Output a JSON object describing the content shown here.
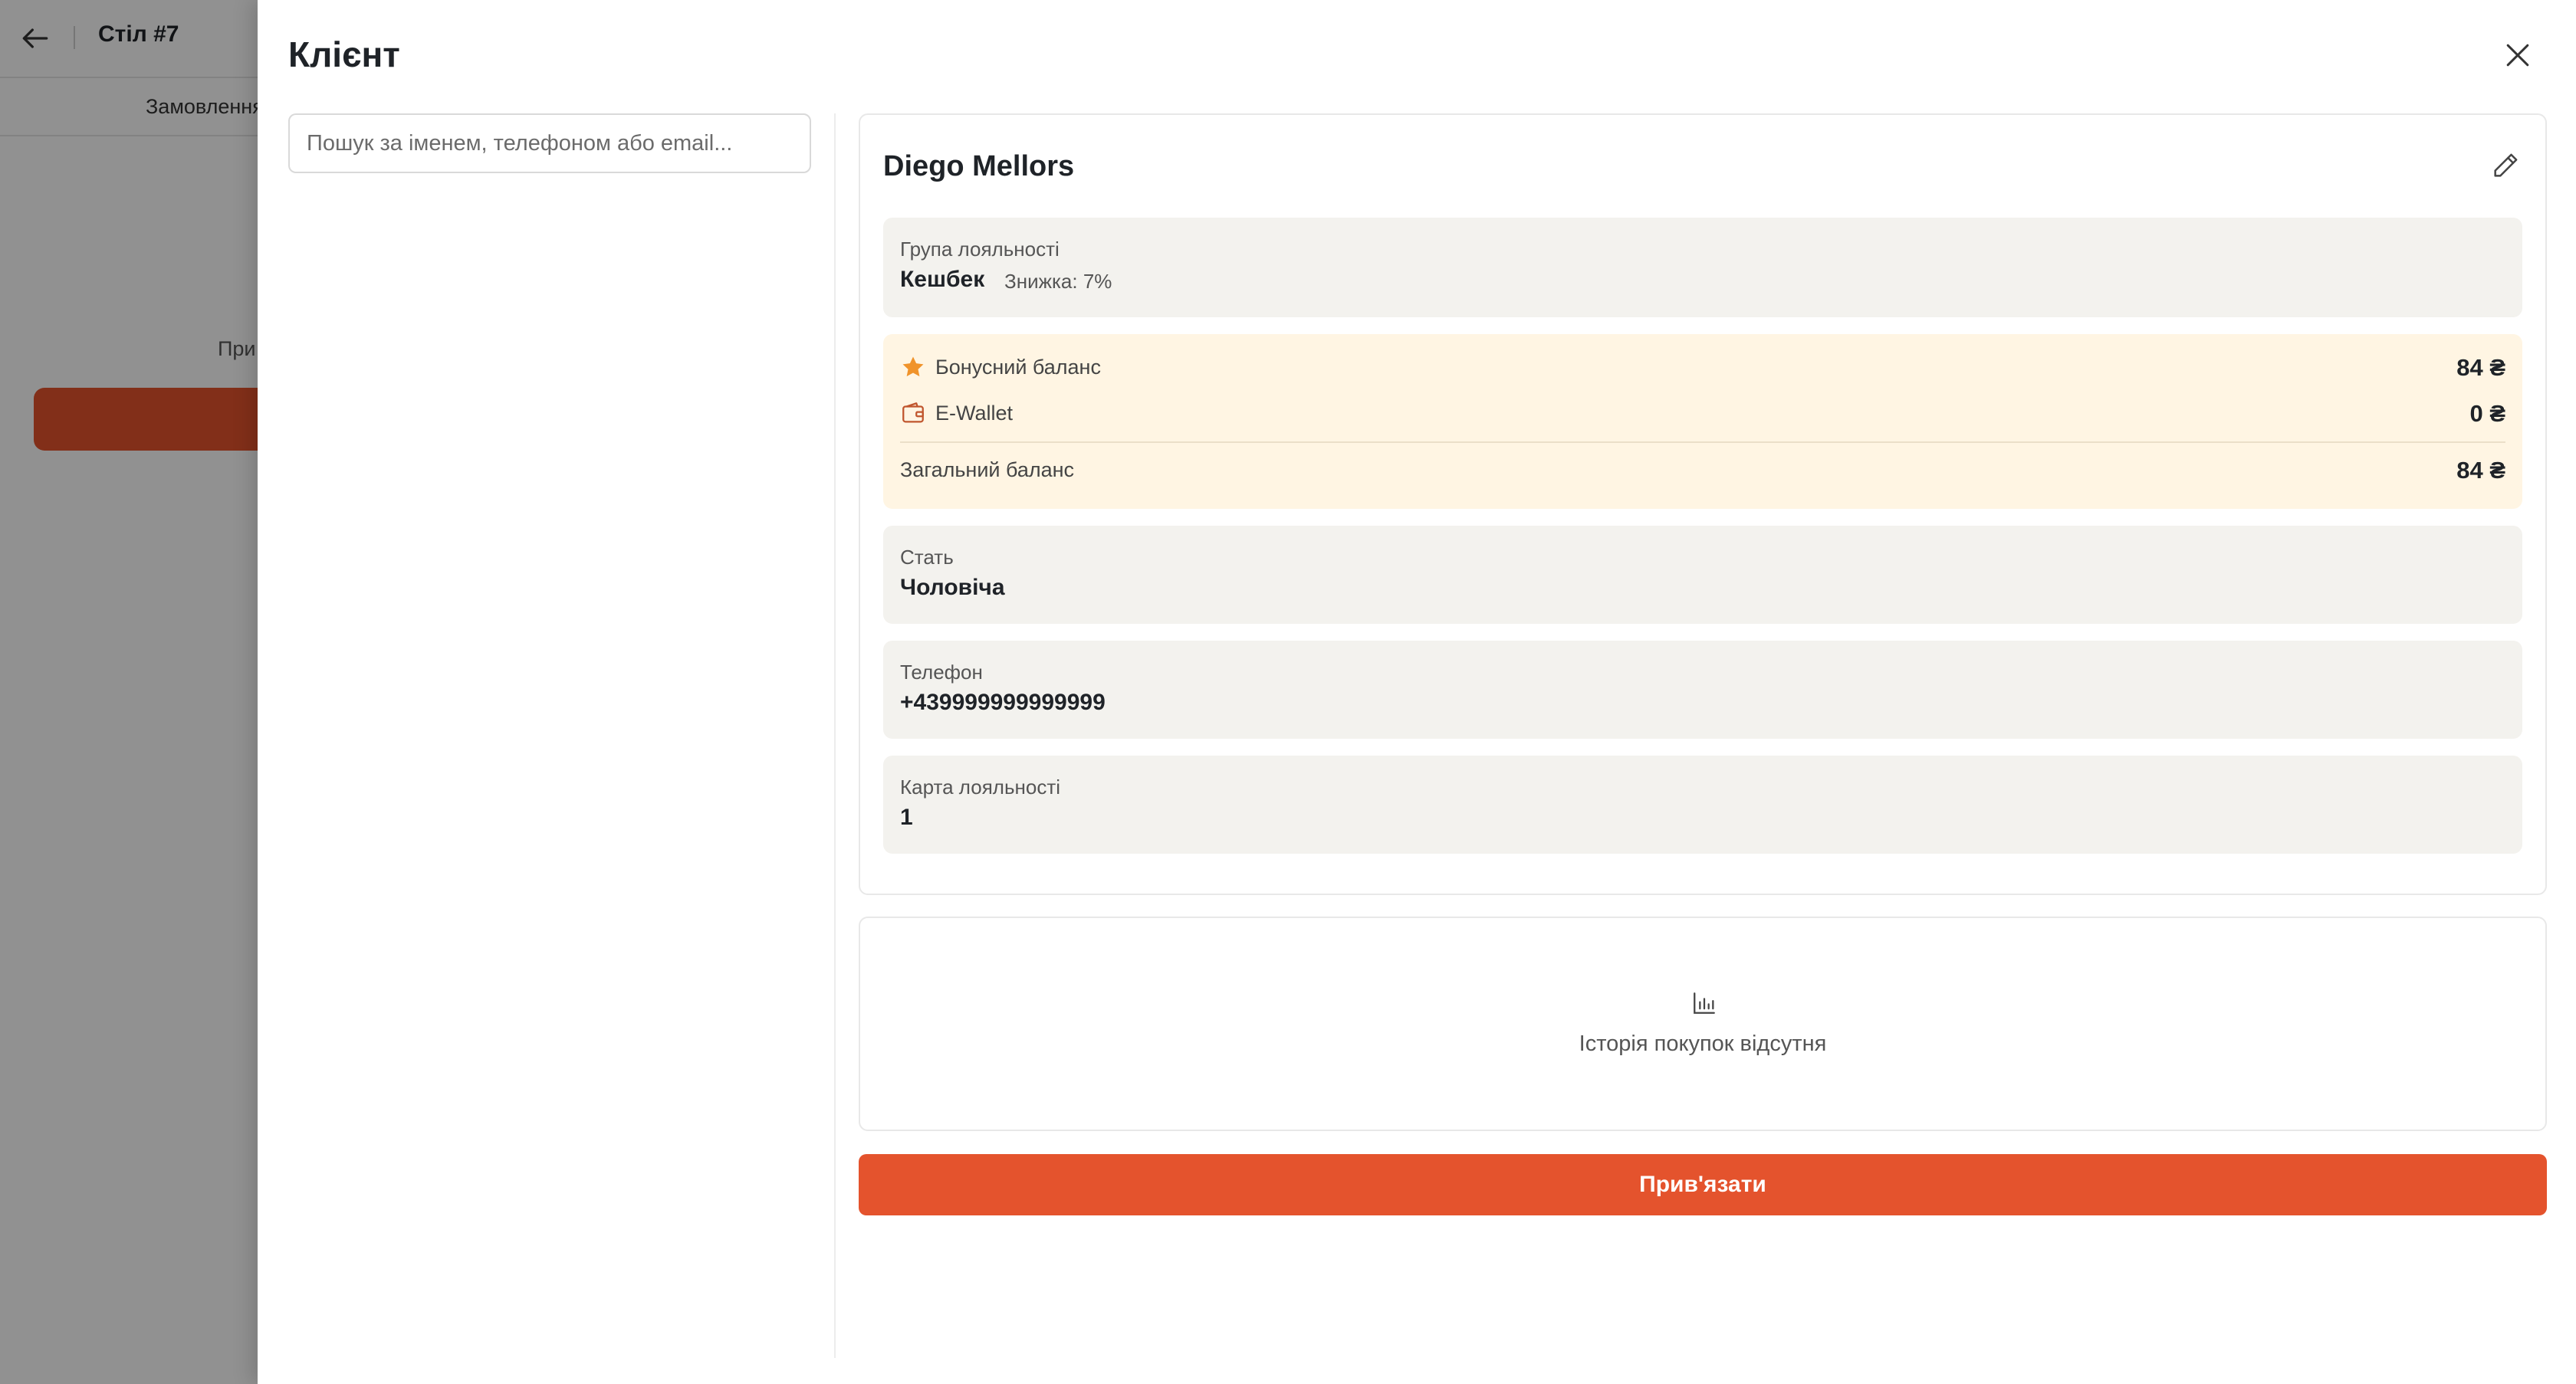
{
  "background": {
    "title": "Стіл #7",
    "tab_label": "Замовлення",
    "side_label": "При"
  },
  "drawer": {
    "title": "Клієнт",
    "search": {
      "placeholder": "Пошук за іменем, телефоном або email...",
      "value": ""
    }
  },
  "client": {
    "name": "Diego Mellors",
    "loyalty_group": {
      "label": "Група лояльності",
      "name": "Кешбек",
      "discount": "Знижка: 7%"
    },
    "balances": {
      "bonus_label": "Бонусний баланс",
      "bonus_value": "84 ₴",
      "wallet_label": "E-Wallet",
      "wallet_value": "0 ₴",
      "total_label": "Загальний баланс",
      "total_value": "84 ₴"
    },
    "gender": {
      "label": "Стать",
      "value": "Чоловіча"
    },
    "phone": {
      "label": "Телефон",
      "value": "+439999999999999"
    },
    "loyalty_card": {
      "label": "Карта лояльності",
      "value": "1"
    }
  },
  "history": {
    "empty_text": "Історія покупок відсутня",
    "icon": "bar-chart-icon"
  },
  "actions": {
    "bind_label": "Прив'язати"
  },
  "colors": {
    "accent": "#e4532d",
    "bonus_star": "#f0932b",
    "balance_bg": "#fff5e3",
    "info_bg": "#f3f2ee"
  }
}
